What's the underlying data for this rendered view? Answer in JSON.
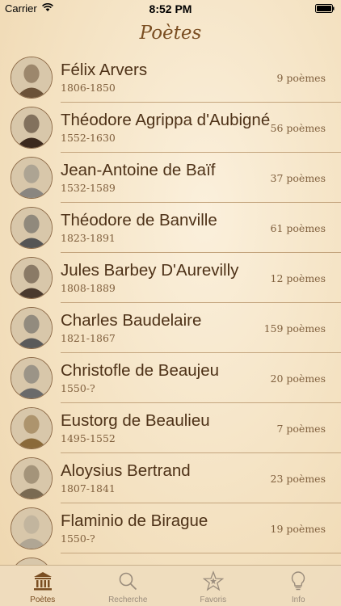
{
  "status": {
    "carrier": "Carrier",
    "time": "8:52 PM"
  },
  "nav": {
    "title": "Poètes"
  },
  "poets": [
    {
      "name": "Félix Arvers",
      "dates": "1806-1850",
      "count": "9 poèmes",
      "avatar_color": "#6b5238"
    },
    {
      "name": "Théodore Agrippa d'Aubigné",
      "dates": "1552-1630",
      "count": "56 poèmes",
      "avatar_color": "#3c2a1e"
    },
    {
      "name": "Jean-Antoine de Baïf",
      "dates": "1532-1589",
      "count": "37 poèmes",
      "avatar_color": "#8a8680"
    },
    {
      "name": "Théodore de Banville",
      "dates": "1823-1891",
      "count": "61 poèmes",
      "avatar_color": "#555555"
    },
    {
      "name": "Jules Barbey D'Aurevilly",
      "dates": "1808-1889",
      "count": "12 poèmes",
      "avatar_color": "#4a3a2e"
    },
    {
      "name": "Charles Baudelaire",
      "dates": "1821-1867",
      "count": "159 poèmes",
      "avatar_color": "#5a5a5a"
    },
    {
      "name": "Christofle de Beaujeu",
      "dates": "1550-?",
      "count": "20 poèmes",
      "avatar_color": "#6a6a6a"
    },
    {
      "name": "Eustorg de Beaulieu",
      "dates": "1495-1552",
      "count": "7 poèmes",
      "avatar_color": "#8a6a3a"
    },
    {
      "name": "Aloysius Bertrand",
      "dates": "1807-1841",
      "count": "23 poèmes",
      "avatar_color": "#7a6a52"
    },
    {
      "name": "Flaminio de Birague",
      "dates": "1550-?",
      "count": "19 poèmes",
      "avatar_color": "#b0a694"
    },
    {
      "name": "",
      "dates": "",
      "count": "",
      "avatar_color": "#3a2a1e"
    }
  ],
  "tabs": [
    {
      "label": "Poètes",
      "icon": "building-icon",
      "active": true
    },
    {
      "label": "Recherche",
      "icon": "search-icon",
      "active": false
    },
    {
      "label": "Favoris",
      "icon": "star-icon",
      "active": false
    },
    {
      "label": "Info",
      "icon": "lightbulb-icon",
      "active": false
    }
  ],
  "colors": {
    "accent": "#7a4e22",
    "inactive": "#9a8c7c",
    "background": "#f4e2c2"
  }
}
